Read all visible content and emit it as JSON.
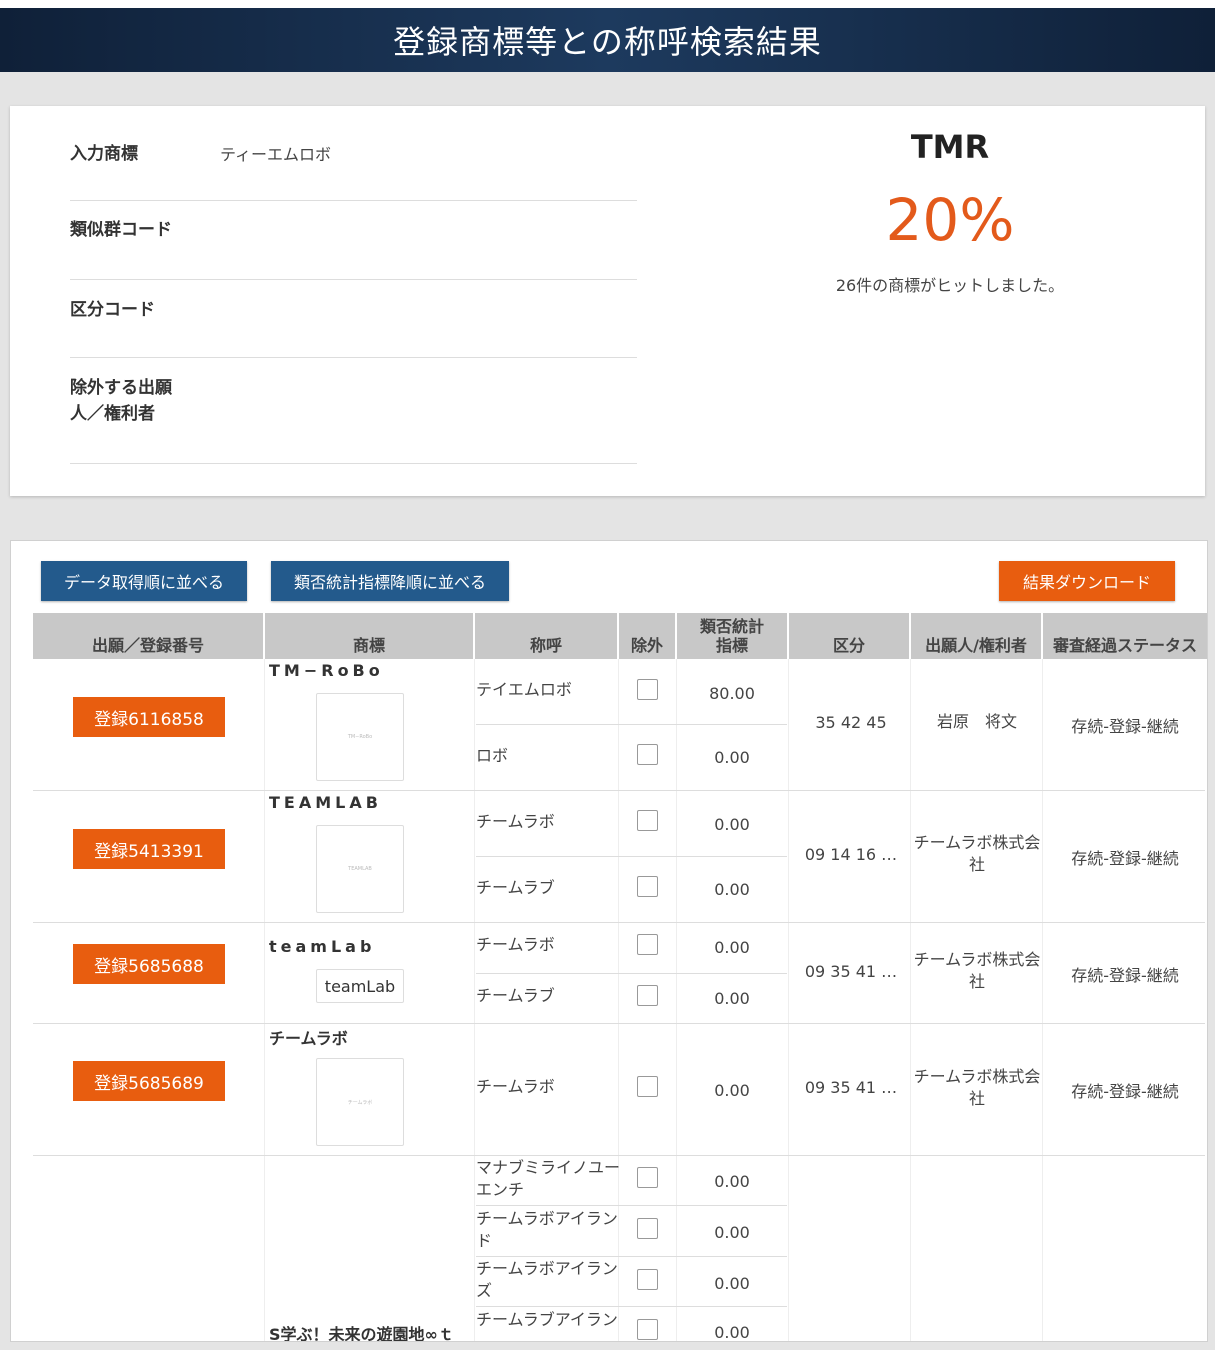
{
  "header": {
    "title": "登録商標等との称呼検索結果"
  },
  "form": {
    "input_label": "入力商標",
    "input_value": "ティーエムロボ",
    "group_code_label": "類似群コード",
    "class_code_label": "区分コード",
    "exclude_label_1": "除外する出願",
    "exclude_label_2": "人／権利者"
  },
  "summary": {
    "name": "TMR",
    "percent": "20%",
    "hits": "26件の商標がヒットしました。"
  },
  "toolbar": {
    "sort_fetch": "データ取得順に並べる",
    "sort_similarity": "類否統計指標降順に並べる",
    "download": "結果ダウンロード"
  },
  "table": {
    "headers": {
      "number": "出願／登録番号",
      "mark": "商標",
      "reading": "称呼",
      "exclude": "除外",
      "score_1": "類否統計",
      "score_2": "指標",
      "class": "区分",
      "applicant": "出願人/権利者",
      "status": "審査経過ステータス"
    },
    "rows": [
      {
        "number": "登録6116858",
        "mark": "TM−RoBo",
        "mark_image_text": "TM−RoBo",
        "readings": [
          {
            "text": "テイエムロボ",
            "score": "80.00"
          },
          {
            "text": "ロボ",
            "score": "0.00"
          }
        ],
        "class": "35 42 45",
        "applicant": "岩原　将文",
        "status": "存続-登録-継続"
      },
      {
        "number": "登録5413391",
        "mark": "TEAMLAB",
        "mark_image_text": "TEAMLAB",
        "readings": [
          {
            "text": "チームラボ",
            "score": "0.00"
          },
          {
            "text": "チームラブ",
            "score": "0.00"
          }
        ],
        "class": "09 14 16 …",
        "applicant": "チームラボ株式会社",
        "status": "存続-登録-継続"
      },
      {
        "number": "登録5685688",
        "mark": "teamLab",
        "mark_image_text": "teamLab",
        "readings": [
          {
            "text": "チームラボ",
            "score": "0.00"
          },
          {
            "text": "チームラブ",
            "score": "0.00"
          }
        ],
        "class": "09 35 41 …",
        "applicant": "チームラボ株式会社",
        "status": "存続-登録-継続"
      },
      {
        "number": "登録5685689",
        "mark": "チームラボ",
        "mark_image_text": "チームラボ",
        "readings": [
          {
            "text": "チームラボ",
            "score": "0.00"
          }
        ],
        "class": "09 35 41 …",
        "applicant": "チームラボ株式会社",
        "status": "存続-登録-継続"
      },
      {
        "number": "",
        "mark": "S学ぶ！未来の遊園地∞ｔ",
        "readings": [
          {
            "text": "マナブミライノユーエンチ",
            "score": "0.00"
          },
          {
            "text": "チームラボアイランド",
            "score": "0.00"
          },
          {
            "text": "チームラボアイランズ",
            "score": "0.00"
          },
          {
            "text": "チームラブアイラン",
            "score": "0.00"
          }
        ],
        "class": "",
        "applicant": "",
        "status": ""
      }
    ]
  }
}
